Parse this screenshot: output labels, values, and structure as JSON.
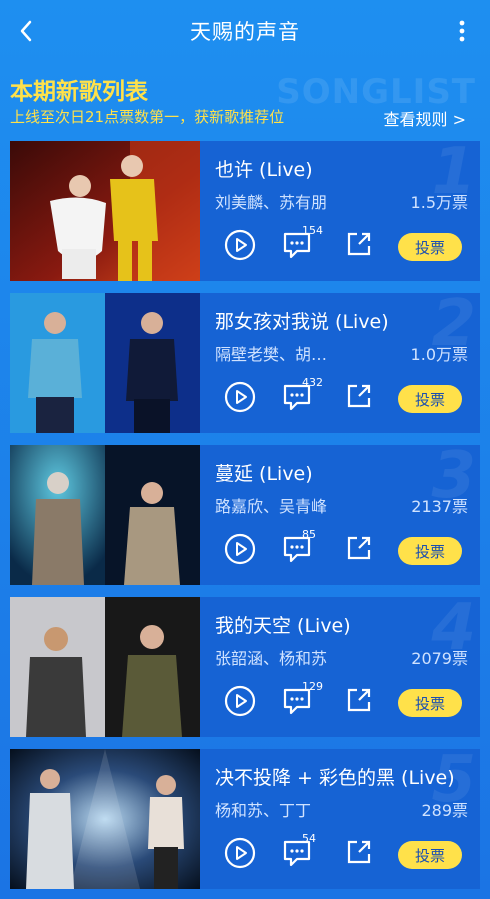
{
  "header": {
    "title": "天赐的声音",
    "back_icon": "chevron-left-icon",
    "more_icon": "more-vertical-icon"
  },
  "section": {
    "title": "本期新歌列表",
    "subtitle": "上线至次日21点票数第一，获新歌推荐位",
    "watermark": "SONGLIST",
    "rules_link": "查看规则 >"
  },
  "colors": {
    "accent_yellow": "#ffe14a",
    "card_blue": "#1663d4",
    "bg_blue": "#1e8ff0"
  },
  "songs": [
    {
      "rank": "1",
      "name": "也许 (Live)",
      "artists": "刘美麟、苏有朋",
      "votes": "1.5万票",
      "comments": "154",
      "vote_label": "投票"
    },
    {
      "rank": "2",
      "name": "那女孩对我说 (Live)",
      "artists": "隔壁老樊、胡…",
      "votes": "1.0万票",
      "comments": "432",
      "vote_label": "投票"
    },
    {
      "rank": "3",
      "name": "蔓延 (Live)",
      "artists": "路嘉欣、吴青峰",
      "votes": "2137票",
      "comments": "85",
      "vote_label": "投票"
    },
    {
      "rank": "4",
      "name": "我的天空 (Live)",
      "artists": "张韶涵、杨和苏",
      "votes": "2079票",
      "comments": "129",
      "vote_label": "投票"
    },
    {
      "rank": "5",
      "name": "决不投降 + 彩色的黑 (Live)",
      "artists": "杨和苏、丁丁",
      "votes": "289票",
      "comments": "54",
      "vote_label": "投票"
    }
  ]
}
